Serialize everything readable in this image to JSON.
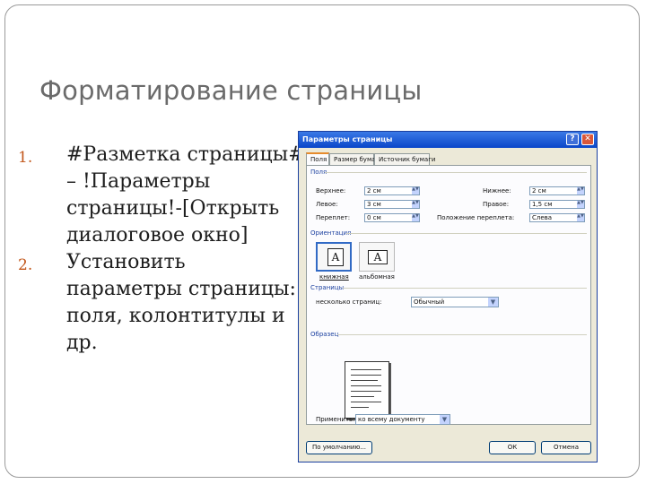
{
  "slide": {
    "title": "Форматирование страницы",
    "items": [
      {
        "number": "1.",
        "text": "#Разметка страницы# – !Параметры страницы!-[Открыть диалоговое окно]"
      },
      {
        "number": "2.",
        "text": "Установить параметры страницы: поля, колонтитулы и др."
      }
    ]
  },
  "dialog": {
    "title": "Параметры страницы",
    "help_glyph": "?",
    "close_glyph": "✕",
    "tabs": [
      "Поля",
      "Размер бумаги",
      "Источник бумаги"
    ],
    "fields_group": "Поля",
    "fields": {
      "top": {
        "label": "Верхнее:",
        "value": "2 см"
      },
      "bottom": {
        "label": "Нижнее:",
        "value": "2 см"
      },
      "left": {
        "label": "Левое:",
        "value": "3 см"
      },
      "right": {
        "label": "Правое:",
        "value": "1,5 см"
      },
      "gutter": {
        "label": "Переплет:",
        "value": "0 см"
      },
      "gutter_pos": {
        "label": "Положение переплета:",
        "value": "Слева"
      }
    },
    "orientation_group": "Ориентация",
    "orientation": {
      "portrait": "книжная",
      "landscape": "альбомная",
      "glyph": "A"
    },
    "pages_group": "Страницы",
    "pages": {
      "label": "несколько страниц:",
      "value": "Обычный"
    },
    "sample_group": "Образец",
    "apply": {
      "label": "Применить:",
      "value": "ко всему документу"
    },
    "buttons": {
      "default": "По умолчанию...",
      "ok": "ОК",
      "cancel": "Отмена"
    },
    "spin_glyph": "▲▼",
    "dropdown_glyph": "▼"
  }
}
